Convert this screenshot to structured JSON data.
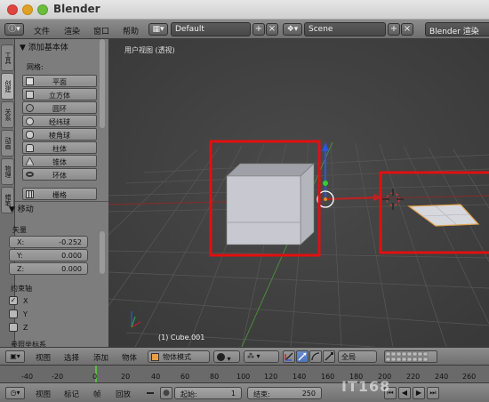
{
  "window": {
    "title": "Blender"
  },
  "info_header": {
    "menus": [
      "文件",
      "渲染",
      "窗口",
      "帮助"
    ],
    "layout_value": "Default",
    "scene_value": "Scene",
    "render_engine": "Blender 渲染"
  },
  "tabs": [
    "工具",
    "创建",
    "关系",
    "动画",
    "物理",
    "蜡笔"
  ],
  "tool_shelf": {
    "add_primitive_title": "添加基本体",
    "mesh_label": "网格:",
    "mesh_buttons": [
      "平面",
      "立方体",
      "圆环",
      "经纬球",
      "棱角球",
      "柱体",
      "锥体",
      "环体",
      "栅格"
    ],
    "operator_title": "移动",
    "vector_label": "矢量",
    "vector_fields": [
      {
        "key": "X:",
        "value": "-0.252"
      },
      {
        "key": "Y:",
        "value": "0.000"
      },
      {
        "key": "Z:",
        "value": "0.000"
      }
    ],
    "constraint_label": "约束轴",
    "constraint_axes": [
      {
        "label": "X",
        "checked": true
      },
      {
        "label": "Y",
        "checked": false
      },
      {
        "label": "Z",
        "checked": false
      }
    ],
    "orientation_label": "参照坐标系"
  },
  "viewport": {
    "title": "用户视图 (透视)",
    "object_label": "(1) Cube.001",
    "highlight_color": "#e01010"
  },
  "viewport_header": {
    "menus": [
      "视图",
      "选择",
      "添加",
      "物体"
    ],
    "mode": "物体模式",
    "pivot": "全局"
  },
  "timeline": {
    "ticks": [
      "-40",
      "-20",
      "0",
      "20",
      "40",
      "60",
      "80",
      "100",
      "120",
      "140",
      "160",
      "180",
      "200",
      "220",
      "240",
      "260"
    ],
    "menus": [
      "视图",
      "标记",
      "帧",
      "回放"
    ],
    "start_label": "起始:",
    "start_value": "1",
    "end_label": "结束:",
    "end_value": "250"
  },
  "watermark": "IT168"
}
